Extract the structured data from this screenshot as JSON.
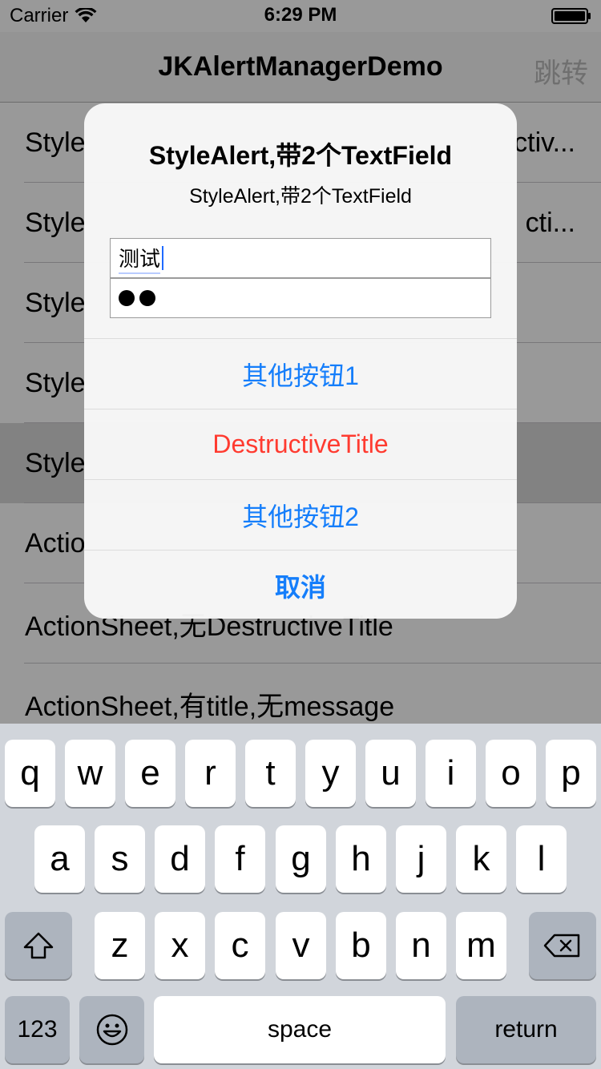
{
  "status_bar": {
    "carrier": "Carrier",
    "time": "6:29 PM",
    "wifi_icon": "wifi-icon",
    "battery_icon": "battery-icon"
  },
  "nav": {
    "title": "JKAlertManagerDemo",
    "right_button": "跳转"
  },
  "table": {
    "rows": [
      {
        "left": "Style",
        "right": "ctiv..."
      },
      {
        "left": "Style",
        "right": "cti..."
      },
      {
        "left": "Style",
        "right": ""
      },
      {
        "left": "Style",
        "right": ""
      },
      {
        "left": "Style",
        "right": ""
      },
      {
        "left": "Actio",
        "right": ""
      },
      {
        "left": "ActionSheet,无DestructiveTitle",
        "right": ""
      },
      {
        "left": "ActionSheet,有title,无message",
        "right": ""
      }
    ]
  },
  "alert": {
    "title": "StyleAlert,带2个TextField",
    "message": "StyleAlert,带2个TextField",
    "text_field_1_value": "测试",
    "buttons": {
      "other1": "其他按钮1",
      "destructive": "DestructiveTitle",
      "other2": "其他按钮2",
      "cancel": "取消"
    }
  },
  "keyboard": {
    "row1": [
      "q",
      "w",
      "e",
      "r",
      "t",
      "y",
      "u",
      "i",
      "o",
      "p"
    ],
    "row2": [
      "a",
      "s",
      "d",
      "f",
      "g",
      "h",
      "j",
      "k",
      "l"
    ],
    "row3": [
      "z",
      "x",
      "c",
      "v",
      "b",
      "n",
      "m"
    ],
    "numbers": "123",
    "space": "space",
    "return": "return"
  },
  "colors": {
    "accent": "#157efb",
    "destructive": "#ff3b30",
    "keyboard_bg": "#d1d5db"
  }
}
